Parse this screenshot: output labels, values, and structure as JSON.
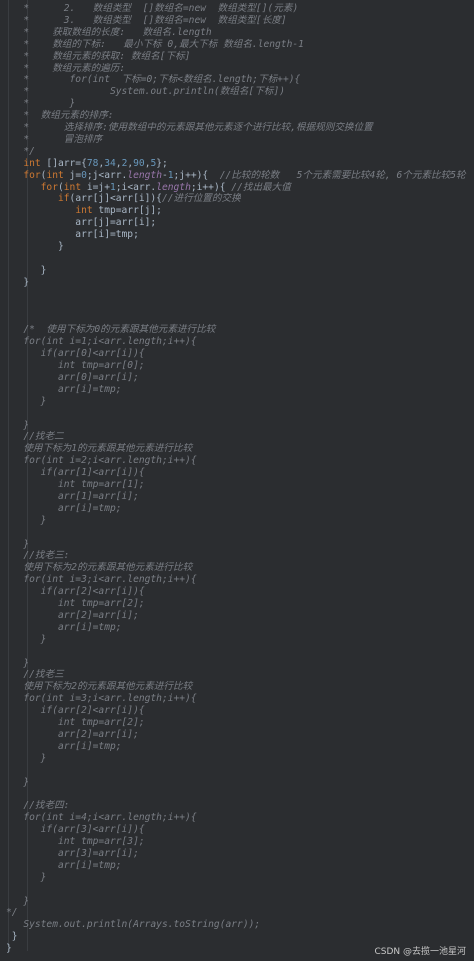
{
  "watermark": "CSDN @去揽一池星河",
  "code_lines": [
    "   *      2.   数组类型  []数组名=new  数组类型[](元素)",
    "   *      3.   数组类型  []数组名=new  数组类型[长度]",
    "   *    获取数组的长度:   数组名.length",
    "   *    数组的下标:   最小下标 0,最大下标 数组名.length-1",
    "   *    数组元素的获取: 数组名[下标]",
    "   *    数组元素的遍历:",
    "   *       for(int  下标=0;下标<数组名.length;下标++){",
    "   *              System.out.println(数组名[下标])",
    "   *       }",
    "   *  数组元素的排序:",
    "   *      选择排序:使用数组中的元素跟其他元素逐个进行比较,根据规则交换位置",
    "   *      冒泡排序",
    "   */",
    "   int []arr={78,34,2,90,5};",
    "   for(int j=0;j<arr.length-1;j++){  //比较的轮数   5个元素需要比较4轮, 6个元素比较5轮",
    "      for(int i=j+1;i<arr.length;i++){ //找出最大值",
    "         if(arr[j]<arr[i]){//进行位置的交换",
    "            int tmp=arr[j];",
    "            arr[j]=arr[i];",
    "            arr[i]=tmp;",
    "         }",
    "",
    "      }",
    "   }",
    "",
    "",
    "",
    "   /*  使用下标为0的元素跟其他元素进行比较",
    "   for(int i=1;i<arr.length;i++){",
    "      if(arr[0]<arr[i]){",
    "         int tmp=arr[0];",
    "         arr[0]=arr[i];",
    "         arr[i]=tmp;",
    "      }",
    "",
    "   }",
    "   //找老二",
    "   使用下标为1的元素跟其他元素进行比较",
    "   for(int i=2;i<arr.length;i++){",
    "      if(arr[1]<arr[i]){",
    "         int tmp=arr[1];",
    "         arr[1]=arr[i];",
    "         arr[i]=tmp;",
    "      }",
    "",
    "   }",
    "   //找老三:",
    "   使用下标为2的元素跟其他元素进行比较",
    "   for(int i=3;i<arr.length;i++){",
    "      if(arr[2]<arr[i]){",
    "         int tmp=arr[2];",
    "         arr[2]=arr[i];",
    "         arr[i]=tmp;",
    "      }",
    "",
    "   }",
    "   //找老三",
    "   使用下标为2的元素跟其他元素进行比较",
    "   for(int i=3;i<arr.length;i++){",
    "      if(arr[2]<arr[i]){",
    "         int tmp=arr[2];",
    "         arr[2]=arr[i];",
    "         arr[i]=tmp;",
    "      }",
    "",
    "   }",
    "",
    "   //找老四:",
    "   for(int i=4;i<arr.length;i++){",
    "      if(arr[3]<arr[i]){",
    "         int tmp=arr[3];",
    "         arr[3]=arr[i];",
    "         arr[i]=tmp;",
    "      }",
    "",
    "   }",
    "*/",
    "   System.out.println(Arrays.toString(arr));",
    " }",
    "}"
  ]
}
